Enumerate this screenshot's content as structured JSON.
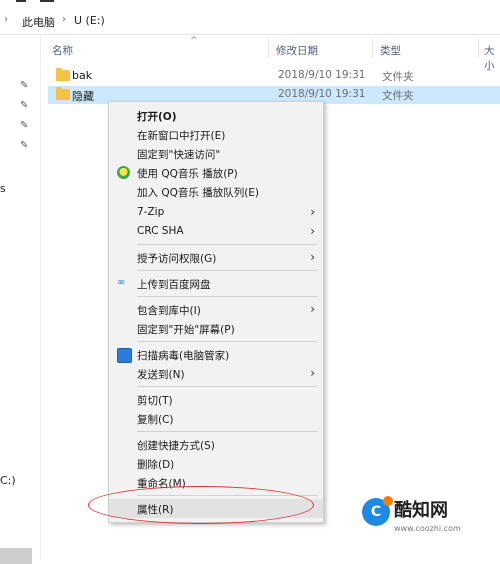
{
  "address": {
    "crumbs": [
      "此电脑",
      "U (E:)"
    ]
  },
  "left_stubs": [
    "s",
    "C:)"
  ],
  "columns": {
    "name": "名称",
    "date": "修改日期",
    "type": "类型",
    "size": "大小"
  },
  "files": [
    {
      "name": "bak",
      "date": "2018/9/10 19:31",
      "type": "文件夹"
    },
    {
      "name": "隐藏",
      "date": "2018/9/10 19:31",
      "type": "文件夹"
    }
  ],
  "context_menu": {
    "items": [
      {
        "label": "打开(O)"
      },
      {
        "label": "在新窗口中打开(E)"
      },
      {
        "label": "固定到\"快速访问\""
      },
      {
        "label": "使用 QQ音乐 播放(P)"
      },
      {
        "label": "加入 QQ音乐 播放队列(E)"
      },
      {
        "label": "7-Zip"
      },
      {
        "label": "CRC SHA"
      },
      {
        "label": "授予访问权限(G)"
      },
      {
        "label": "上传到百度网盘"
      },
      {
        "label": "包含到库中(I)"
      },
      {
        "label": "固定到\"开始\"屏幕(P)"
      },
      {
        "label": "扫描病毒(电脑管家)"
      },
      {
        "label": "发送到(N)"
      },
      {
        "label": "剪切(T)"
      },
      {
        "label": "复制(C)"
      },
      {
        "label": "创建快捷方式(S)"
      },
      {
        "label": "删除(D)"
      },
      {
        "label": "重命名(M)"
      },
      {
        "label": "属性(R)"
      }
    ],
    "submenu_arrow": "›"
  },
  "watermark": {
    "logo_letter": "C",
    "title": "酷知网",
    "url": "www.coozhi.com"
  },
  "colors": {
    "selection": "#cce8ff",
    "menu_bg": "#f2f2f2",
    "annotation": "#dd3333",
    "folder": "#f5c242"
  }
}
